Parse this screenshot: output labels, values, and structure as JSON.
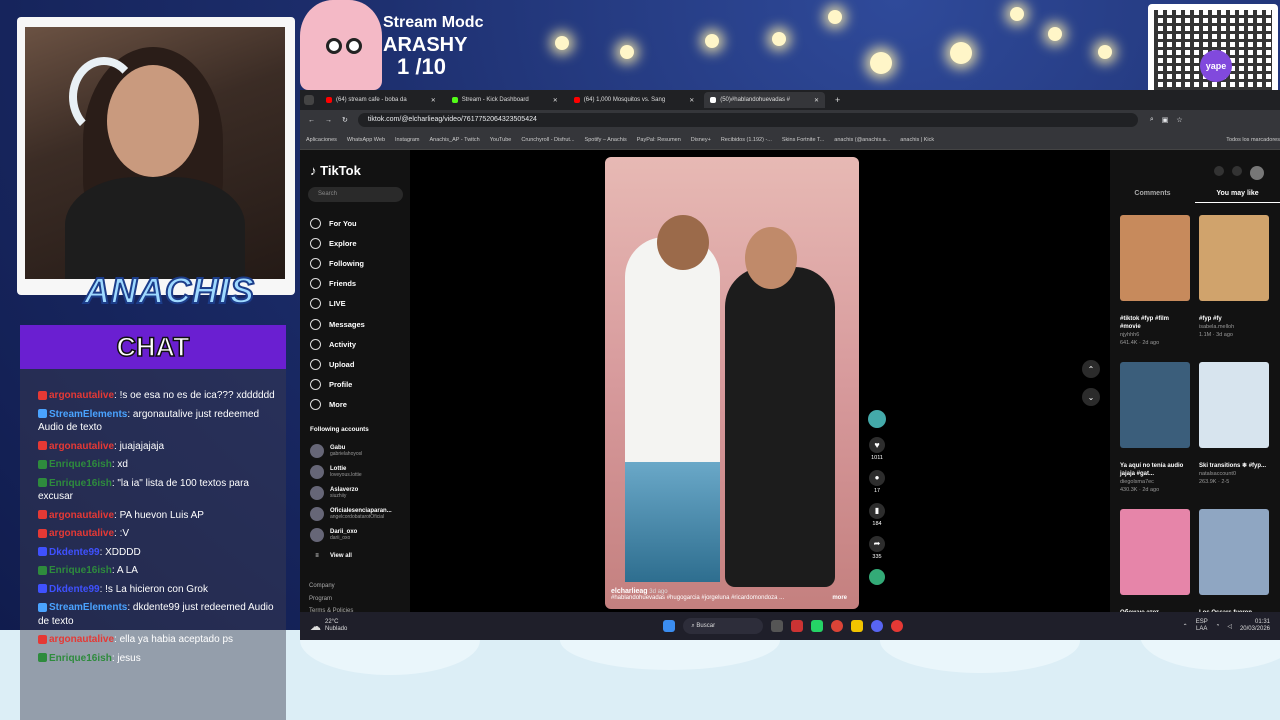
{
  "overlay": {
    "mod_line": "Stream Modc",
    "mod_name": "ARASHY",
    "mod_count": "1  /10",
    "streamer": "ANACHIS",
    "chat_title": "CHAT",
    "qr_brand": "yape"
  },
  "chat": [
    {
      "user": "argonautalive",
      "user_color": "#e53935",
      "text": ": !s oe esa no es de ica??? xdddddd"
    },
    {
      "user": "StreamElements",
      "user_color": "#4aa3ff",
      "text": ": argonautalive just redeemed Audio de texto"
    },
    {
      "user": "argonautalive",
      "user_color": "#e53935",
      "text": ": juajajajaja"
    },
    {
      "user": "Enrique16ish",
      "user_color": "#2e8b3d",
      "text": ": xd"
    },
    {
      "user": "Enrique16ish",
      "user_color": "#2e8b3d",
      "text": ": \"la ia\" lista de 100 textos para excusar"
    },
    {
      "user": "argonautalive",
      "user_color": "#e53935",
      "text": ": PA huevon Luis AP"
    },
    {
      "user": "argonautalive",
      "user_color": "#e53935",
      "text": ": :V"
    },
    {
      "user": "Dkdente99",
      "user_color": "#3f51ff",
      "text": ": XDDDD"
    },
    {
      "user": "Enrique16ish",
      "user_color": "#2e8b3d",
      "text": ": A LA"
    },
    {
      "user": "Dkdente99",
      "user_color": "#3f51ff",
      "text": ": !s La hicieron con Grok"
    },
    {
      "user": "StreamElements",
      "user_color": "#4aa3ff",
      "text": ": dkdente99 just redeemed Audio de texto"
    },
    {
      "user": "argonautalive",
      "user_color": "#e53935",
      "text": ": ella ya habia aceptado ps"
    },
    {
      "user": "Enrique16ish",
      "user_color": "#2e8b3d",
      "text": ": jesus"
    }
  ],
  "browser": {
    "tabs": [
      {
        "label": "(64) stream cafe - boba da",
        "color": "#ff0000"
      },
      {
        "label": "Stream - Kick Dashboard",
        "color": "#53fc18"
      },
      {
        "label": "(64) 1,000 Mosquitos vs. Sang",
        "color": "#ff0000"
      },
      {
        "label": "(50)#hablandohuevadas #",
        "color": "#ffffff"
      }
    ],
    "url": "tiktok.com/@elcharlieag/video/7617752064323505424",
    "bookmarks": [
      "Aplicaciones",
      "WhatsApp Web",
      "Instagram",
      "Anachis_AP - Twitch",
      "YouTube",
      "Crunchyroll - Disfrut...",
      "Spotify – Anachis",
      "PayPal: Resumen",
      "Disney+",
      "Recibidos (1.192) -...",
      "Skins Fortnite T...",
      "anachis (@anachis.a...",
      "anachis | Kick",
      "Todos los marcadores"
    ]
  },
  "tiktok": {
    "logo": "TikTok",
    "search_placeholder": "Search",
    "nav": [
      "For You",
      "Explore",
      "Following",
      "Friends",
      "LIVE",
      "Messages",
      "Activity",
      "Upload",
      "Profile",
      "More"
    ],
    "following_header": "Following accounts",
    "accounts": [
      {
        "name": "Gabu",
        "handle": "gabrielahoyosl"
      },
      {
        "name": "Lottie",
        "handle": "loveyous.lottie"
      },
      {
        "name": "Aslaverzo",
        "handle": "siuzhiiy"
      },
      {
        "name": "Oficialesenciaparan...",
        "handle": "angelcordobatarotOficial"
      },
      {
        "name": "Darii_oxo",
        "handle": "darii_oxo"
      }
    ],
    "see_all": "View all",
    "footer": [
      "Company",
      "Program",
      "Terms & Policies"
    ],
    "video": {
      "author": "elcharlieag",
      "age": "3d ago",
      "caption": "#hablandohuevadas #hugogarcia #jorgeluna #ricardomondoza ...",
      "more": "more",
      "likes": "1011",
      "comments": "17",
      "saves": "184",
      "shares": "335"
    },
    "right_tabs": [
      "Comments",
      "You may like"
    ],
    "suggestions": [
      {
        "title": "#tiktok #fyp #film #movie",
        "user": "njyhhh6",
        "meta": "641.4K · 2d ago",
        "color": "#c78a5c"
      },
      {
        "title": "#fyp #fy",
        "user": "isabela.melloh",
        "meta": "1.1M · 3d ago",
        "color": "#d0a36c"
      },
      {
        "title": "Ya aquí no tenía audio jajaja #gat...",
        "user": "diegolsma7ec",
        "meta": "430.3K · 2d ago",
        "color": "#3b5e7b"
      },
      {
        "title": "Ski transitions ❄ #fyp...",
        "user": "natalsaccount0",
        "meta": "263.9K · 2-5",
        "color": "#d7e4ee"
      },
      {
        "title": "Обожаю этот",
        "user": "",
        "meta": "",
        "color": "#e685a9"
      },
      {
        "title": "Los Oscars fueron",
        "user": "",
        "meta": "",
        "color": "#8fa6c2"
      }
    ]
  },
  "taskbar": {
    "weather_temp": "22°C",
    "weather_desc": "Nublado",
    "search": "Buscar",
    "lang1": "ESP",
    "lang2": "LAA",
    "time": "01:31",
    "date": "20/03/2026"
  }
}
